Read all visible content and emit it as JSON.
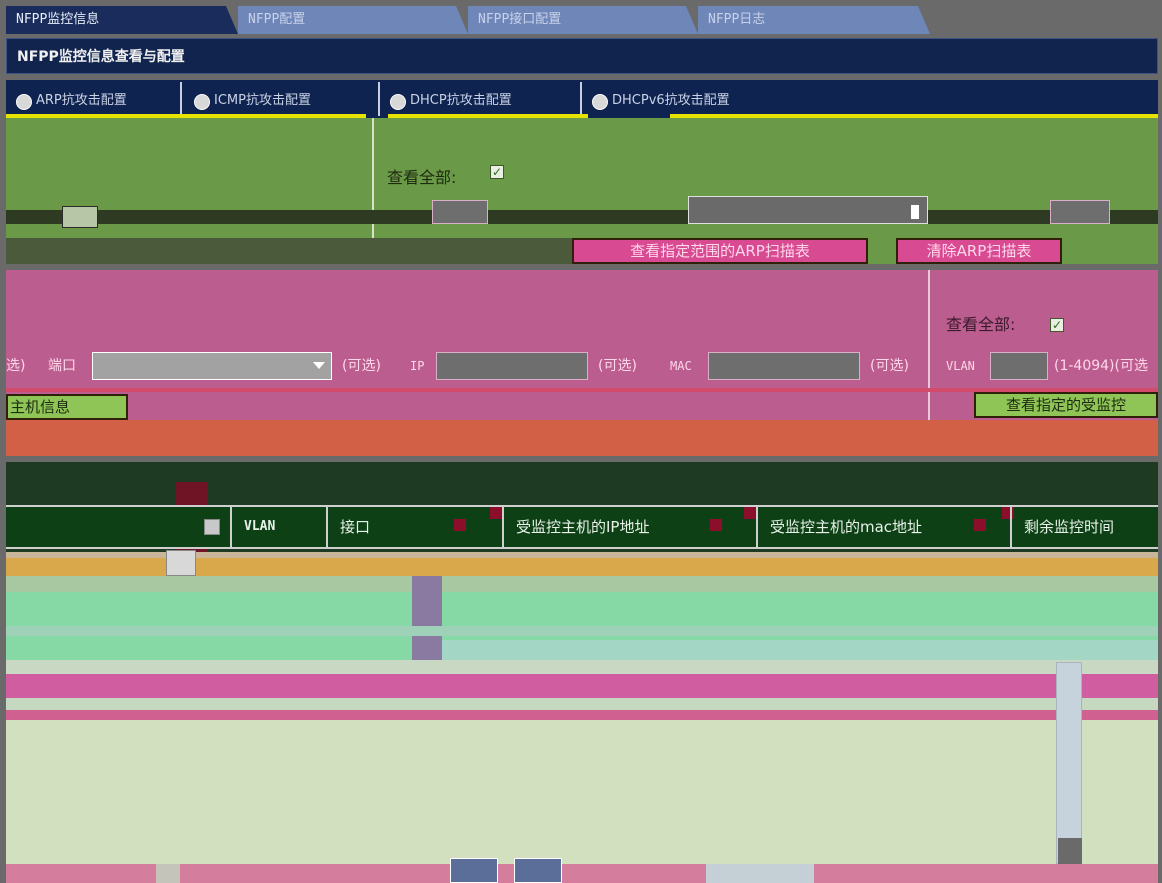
{
  "tabs": [
    {
      "label": "NFPP监控信息",
      "active": true
    },
    {
      "label": "NFPP配置",
      "active": false
    },
    {
      "label": "NFPP接口配置",
      "active": false
    },
    {
      "label": "NFPP日志",
      "active": false
    }
  ],
  "header": {
    "title": "NFPP监控信息查看与配置"
  },
  "subtabs": [
    {
      "label": "ARP抗攻击配置",
      "icon": "globe-icon"
    },
    {
      "label": "ICMP抗攻击配置",
      "icon": "globe-icon"
    },
    {
      "label": "DHCP抗攻击配置",
      "icon": "globe-icon"
    },
    {
      "label": "DHCPv6抗攻击配置",
      "icon": "globe-icon"
    }
  ],
  "arp": {
    "view_all_label": "查看全部:",
    "view_all_checked": true,
    "btn_view_range": "查看指定范围的ARP扫描表",
    "btn_clear": "清除ARP扫描表"
  },
  "monitored": {
    "view_all_label": "查看全部:",
    "view_all_checked": true,
    "optional_left": "选)",
    "port_label": "端口",
    "optional_1": "(可选)",
    "ip_label": "IP",
    "optional_2": "(可选)",
    "mac_label": "MAC",
    "optional_3": "(可选)",
    "vlan_label": "VLAN",
    "vlan_hint": "(1-4094)(可选",
    "btn_left": "主机信息",
    "btn_view": "查看指定的受监控"
  },
  "table": {
    "columns": [
      "VLAN",
      "接口",
      "受监控主机的IP地址",
      "受监控主机的mac地址",
      "剩余监控时间"
    ]
  },
  "colors": {
    "tab_active": "#1a2c5b",
    "tab_inactive": "#6f86b8",
    "arp_bg": "#6a9a48",
    "pink_bg": "#bc5d8f",
    "button_green": "#8fc456",
    "button_pink": "#d84a92"
  }
}
